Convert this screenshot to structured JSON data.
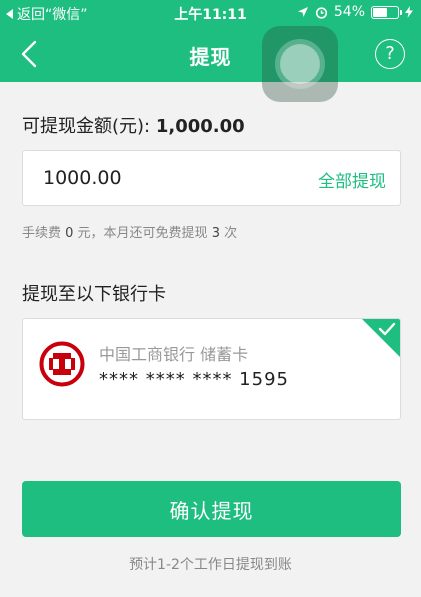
{
  "status_bar": {
    "back_label": "返回“微信”",
    "time": "上午11:11",
    "battery": "54%",
    "battery_level": 0.54
  },
  "nav": {
    "title": "提现",
    "back_icon": "chevron-left-icon",
    "help_icon": "question-circle-icon",
    "help_symbol": "?"
  },
  "amount": {
    "label": "可提现金额(元): ",
    "value": "1,000.00",
    "input_value": "1000.00",
    "withdraw_all_label": "全部提现"
  },
  "fee": {
    "prefix": "手续费 ",
    "fee_value": "0",
    "middle": " 元，本月还可免费提现 ",
    "free_count": "3",
    "suffix": " 次"
  },
  "card_section": {
    "title": "提现至以下银行卡"
  },
  "card": {
    "bank_name": "中国工商银行 储蓄卡",
    "number": "**** **** **** 1595",
    "logo_icon": "icbc-logo-icon",
    "selected_icon": "checkmark-icon"
  },
  "actions": {
    "confirm_label": "确认提现",
    "eta": "预计1-2个工作日提现到账"
  },
  "colors": {
    "accent": "#1ebd80",
    "bank_red": "#c7000b"
  }
}
